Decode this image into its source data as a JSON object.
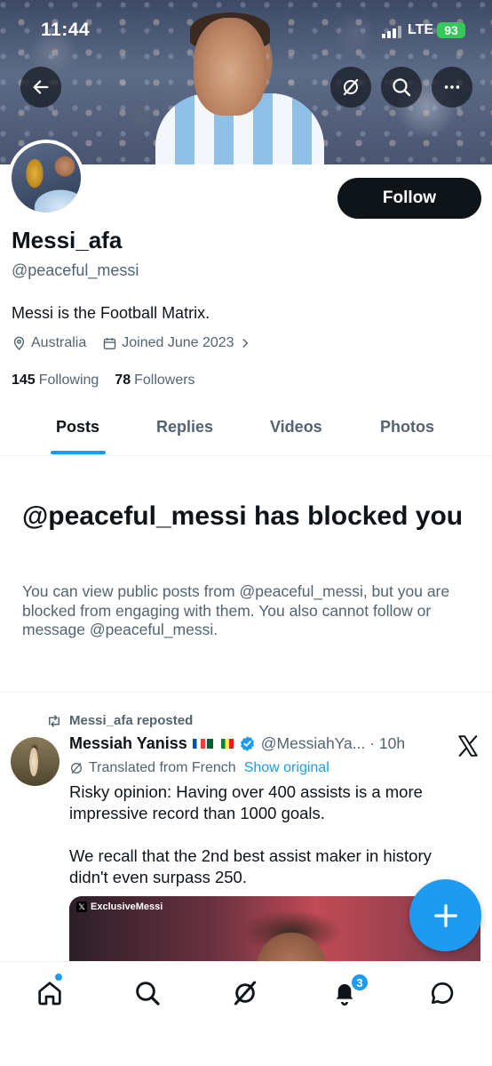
{
  "status_bar": {
    "time": "11:44",
    "network": "LTE",
    "battery": "93"
  },
  "profile": {
    "display_name": "Messi_afa",
    "handle": "@peaceful_messi",
    "bio": "Messi is the Football Matrix.",
    "location": "Australia",
    "joined": "Joined June 2023",
    "following_count": "145",
    "following_label": "Following",
    "followers_count": "78",
    "followers_label": "Followers",
    "follow_label": "Follow"
  },
  "tabs": [
    {
      "label": "Posts",
      "active": true
    },
    {
      "label": "Replies",
      "active": false
    },
    {
      "label": "Videos",
      "active": false
    },
    {
      "label": "Photos",
      "active": false
    }
  ],
  "blocked": {
    "title": "@peaceful_messi has blocked you",
    "message": "You can view public posts from @peaceful_messi, but you are blocked from engaging with them. You also cannot follow or message @peaceful_messi."
  },
  "tweet": {
    "repost_label": "Messi_afa reposted",
    "author_name": "Messiah Yaniss",
    "author_handle_time": "@MessiahYa... · 10h",
    "translated_label": "Translated from French",
    "show_original_label": "Show original",
    "text_1": "Risky opinion: Having over 400 assists is a more impressive record than 1000 goals.",
    "text_2": "We recall that the 2nd best assist maker in history didn't even surpass 250.",
    "media_watermark": "ExclusiveMessi"
  },
  "nav": {
    "notifications_badge": "3"
  },
  "colors": {
    "accent": "#1d9bf0",
    "text_primary": "#0f1419",
    "text_secondary": "#536471",
    "battery": "#34c759"
  },
  "icons": [
    "back-arrow-icon",
    "grok-icon",
    "search-icon",
    "more-icon",
    "location-icon",
    "calendar-icon",
    "chevron-right-icon",
    "repost-icon",
    "verified-icon",
    "x-logo-icon",
    "translate-icon",
    "plus-icon",
    "home-icon",
    "explore-icon",
    "grok-icon",
    "bell-icon",
    "messages-icon"
  ]
}
